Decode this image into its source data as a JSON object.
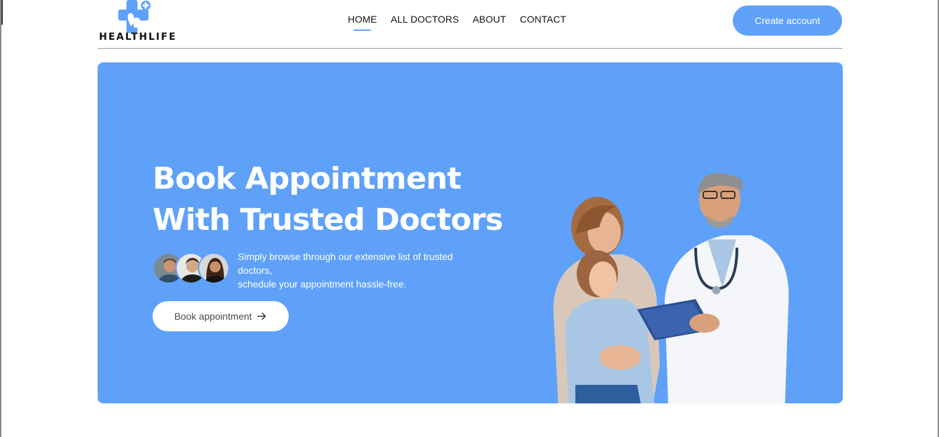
{
  "header": {
    "logo_text": "HEALTHLIFE",
    "logo_icon": "medical-cross-hands-icon",
    "nav": [
      {
        "label": "HOME",
        "active": true
      },
      {
        "label": "ALL DOCTORS",
        "active": false
      },
      {
        "label": "ABOUT",
        "active": false
      },
      {
        "label": "CONTACT",
        "active": false
      }
    ],
    "create_account_label": "Create account"
  },
  "hero": {
    "title_line1": "Book Appointment",
    "title_line2": "With Trusted Doctors",
    "desc_line1": "Simply browse through our extensive list of trusted",
    "desc_line2": "doctors,",
    "desc_line3": "schedule your appointment hassle-free.",
    "book_button_label": "Book appointment",
    "book_button_icon": "arrow-right-icon",
    "avatar_count": 3
  },
  "colors": {
    "primary": "#5fa1f8",
    "white": "#ffffff",
    "text": "#111111"
  }
}
